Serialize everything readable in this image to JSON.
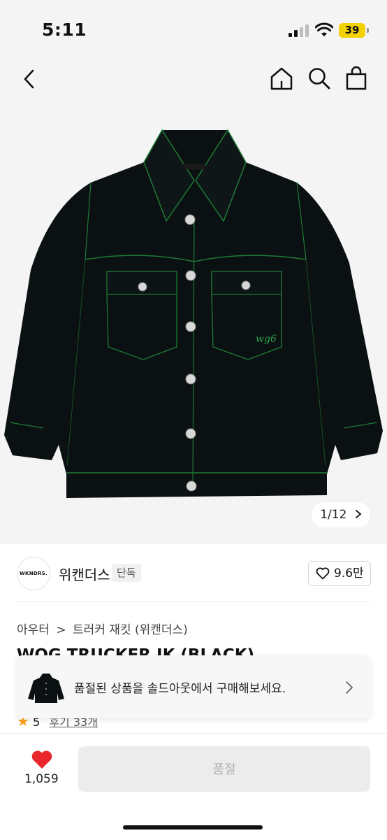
{
  "status_bar": {
    "time": "5:11",
    "battery": "39"
  },
  "nav": {
    "back_icon": "back-chevron-icon",
    "home_icon": "home-icon",
    "search_icon": "search-icon",
    "bag_icon": "shopping-bag-icon"
  },
  "gallery": {
    "counter": "1/12",
    "product_color": "#0b1112",
    "stitch_color": "#1f7a36"
  },
  "brand": {
    "logo_text": "WKNDRS.",
    "name": "위캔더스",
    "badge": "단독",
    "likes": "9.6만"
  },
  "breadcrumb": {
    "category": "아우터",
    "separator": ">",
    "subcategory": "트러커 재킷 (위캔더스)"
  },
  "product": {
    "title": "WOG TRUCKER JK (BLACK)",
    "rating": "5",
    "reviews": "후기 33개"
  },
  "toast": {
    "message": "품절된 상품을 솔드아웃에서 구매해보세요."
  },
  "bottom_bar": {
    "wish_count": "1,059",
    "buy_label": "품절",
    "heart_color": "#e8262b"
  },
  "colors": {
    "background": "#f4f4f4",
    "accent_star": "#f7a21b"
  }
}
